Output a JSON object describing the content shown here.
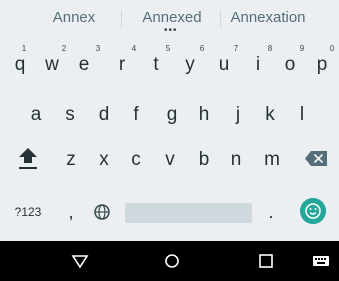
{
  "suggestions": [
    "Annex",
    "Annexed",
    "Annexation"
  ],
  "rows": {
    "row1": [
      {
        "letter": "q",
        "hint": "1"
      },
      {
        "letter": "w",
        "hint": "2"
      },
      {
        "letter": "e",
        "hint": "3"
      },
      {
        "letter": "r",
        "hint": "4"
      },
      {
        "letter": "t",
        "hint": "5"
      },
      {
        "letter": "y",
        "hint": "6"
      },
      {
        "letter": "u",
        "hint": "7"
      },
      {
        "letter": "i",
        "hint": "8"
      },
      {
        "letter": "o",
        "hint": "9"
      },
      {
        "letter": "p",
        "hint": "0"
      }
    ],
    "row2": [
      "a",
      "s",
      "d",
      "f",
      "g",
      "h",
      "j",
      "k",
      "l"
    ],
    "row3": [
      "z",
      "x",
      "c",
      "v",
      "b",
      "n",
      "m"
    ]
  },
  "bottom": {
    "symbols_label": "?123",
    "comma": ",",
    "period": "."
  },
  "icons": {
    "shift": "shift-icon",
    "backspace": "backspace-icon",
    "globe": "globe-icon",
    "emoji": "emoji-icon",
    "back": "nav-back-icon",
    "home": "nav-home-icon",
    "recents": "nav-recents-icon",
    "keyboard": "keyboard-icon"
  },
  "colors": {
    "keyboard_bg": "#eceff1",
    "accent": "#26a69a",
    "key_text": "#263238",
    "navbar_bg": "#000000"
  }
}
